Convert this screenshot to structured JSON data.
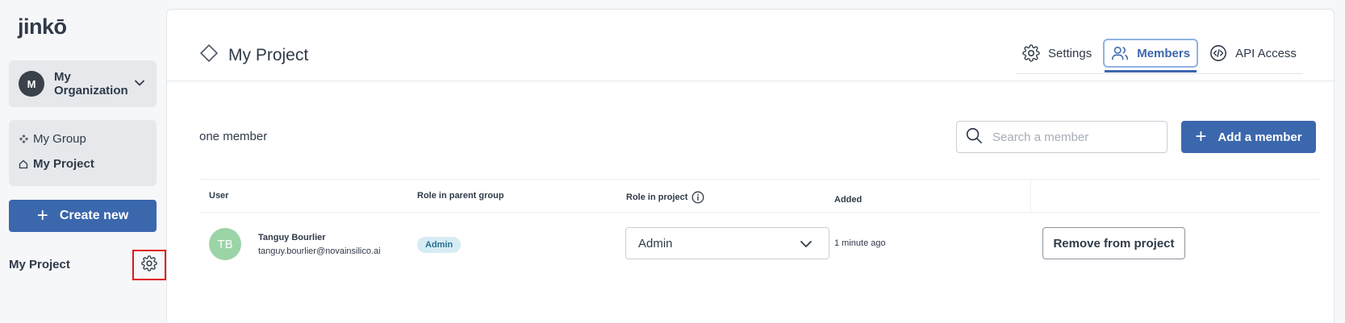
{
  "sidebar": {
    "logo": "jinkō",
    "organization": {
      "initial": "M",
      "name": "My Organization"
    },
    "nav": [
      {
        "label": "My Group",
        "icon": "group-diamond-icon"
      },
      {
        "label": "My Project",
        "icon": "project-home-icon"
      }
    ],
    "create_label": "Create new",
    "project_title": "My Project",
    "settings_icon": "gear-icon"
  },
  "header": {
    "title": "My Project",
    "tabs": [
      {
        "label": "Settings",
        "icon": "gear-icon",
        "active": false
      },
      {
        "label": "Members",
        "icon": "users-icon",
        "active": true
      },
      {
        "label": "API Access",
        "icon": "code-icon",
        "active": false
      }
    ]
  },
  "members": {
    "count_text": "one member",
    "search_placeholder": "Search a member",
    "add_label": "Add a member",
    "columns": {
      "user": "User",
      "parent_role": "Role in parent group",
      "project_role": "Role in project",
      "added": "Added"
    },
    "rows": [
      {
        "initials": "TB",
        "name": "Tanguy Bourlier",
        "email": "tanguy.bourlier@novainsilico.ai",
        "parent_role": "Admin",
        "project_role": "Admin",
        "added": "1 minute ago",
        "remove_label": "Remove from project"
      }
    ]
  },
  "colors": {
    "primary": "#3b67ad",
    "highlight": "#e01515",
    "avatar_green": "#9bd4a6",
    "badge_bg": "#d6ecf4"
  }
}
